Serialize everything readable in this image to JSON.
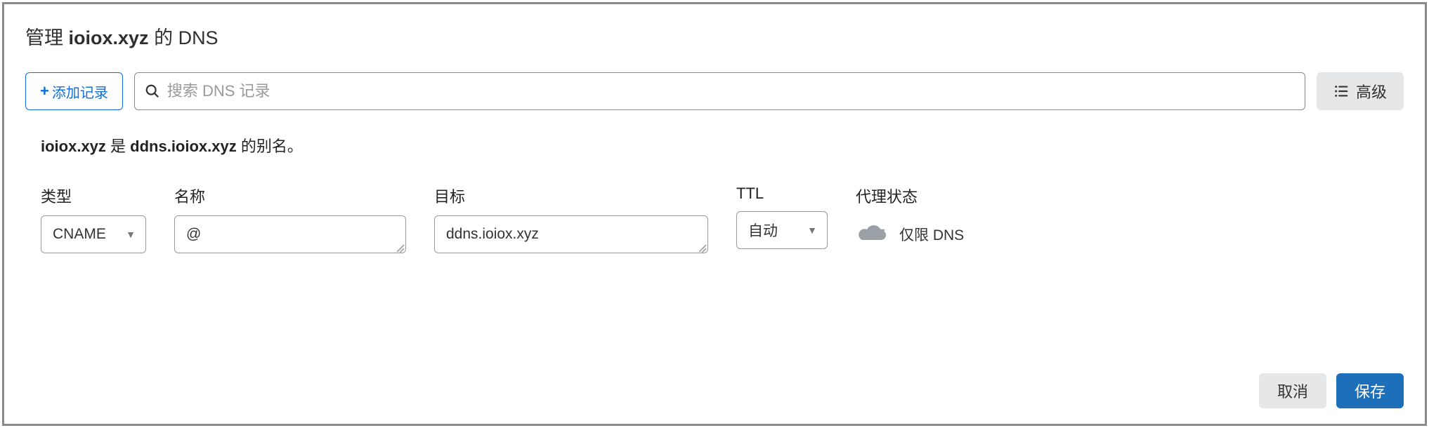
{
  "title": {
    "prefix": "管理 ",
    "domain": "ioiox.xyz",
    "suffix": " 的 DNS"
  },
  "toolbar": {
    "addRecord": "添加记录",
    "searchPlaceholder": "搜索 DNS 记录",
    "advanced": "高级"
  },
  "alias": {
    "domain": "ioiox.xyz",
    "mid": " 是 ",
    "target": "ddns.ioiox.xyz",
    "suffix": " 的别名。"
  },
  "form": {
    "type": {
      "label": "类型",
      "value": "CNAME"
    },
    "name": {
      "label": "名称",
      "value": "@"
    },
    "target": {
      "label": "目标",
      "value": "ddns.ioiox.xyz"
    },
    "ttl": {
      "label": "TTL",
      "value": "自动"
    },
    "proxy": {
      "label": "代理状态",
      "value": "仅限 DNS"
    }
  },
  "footer": {
    "cancel": "取消",
    "save": "保存"
  },
  "colors": {
    "accent": "#0f6fde",
    "primary": "#1c6fb8"
  }
}
